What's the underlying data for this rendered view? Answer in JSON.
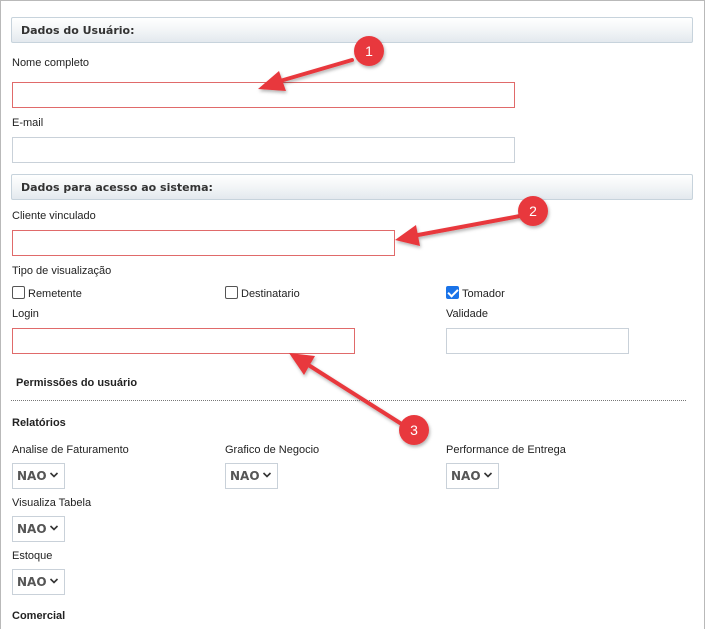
{
  "sections": {
    "user_data": "Dados do Usuário:",
    "system_access": "Dados para acesso ao sistema:"
  },
  "fields": {
    "full_name": {
      "label": "Nome completo",
      "value": ""
    },
    "email": {
      "label": "E-mail",
      "value": ""
    },
    "linked_client": {
      "label": "Cliente vinculado",
      "value": ""
    },
    "view_type": {
      "label": "Tipo de visualização",
      "options": [
        {
          "label": "Remetente",
          "checked": false
        },
        {
          "label": "Destinatario",
          "checked": false
        },
        {
          "label": "Tomador",
          "checked": true
        }
      ]
    },
    "login": {
      "label": "Login",
      "value": ""
    },
    "validity": {
      "label": "Validade",
      "value": ""
    }
  },
  "permissions": {
    "title": "Permissões do usuário",
    "groups": {
      "reports": "Relatórios",
      "commercial": "Comercial"
    },
    "items": [
      {
        "label": "Analise de Faturamento",
        "value": "NAO"
      },
      {
        "label": "Grafico de Negocio",
        "value": "NAO"
      },
      {
        "label": "Performance de Entrega",
        "value": "NAO"
      },
      {
        "label": "Visualiza Tabela",
        "value": "NAO"
      },
      {
        "label": "Estoque",
        "value": "NAO"
      }
    ]
  },
  "annotations": [
    "1",
    "2",
    "3"
  ],
  "colors": {
    "required_border": "#e06a6a",
    "annotation_red": "#e8383d",
    "checkbox_checked": "#1a73e8"
  }
}
